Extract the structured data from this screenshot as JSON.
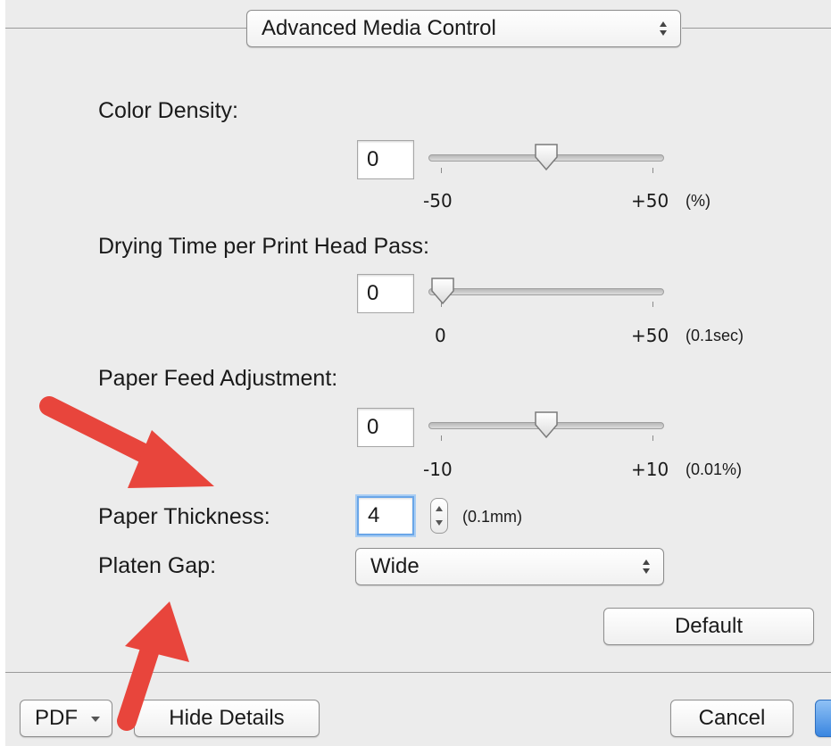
{
  "header": {
    "panel_popup": "Advanced Media Control"
  },
  "sections": {
    "color_density": {
      "label": "Color Density:",
      "value": "0",
      "min_label": "-50",
      "max_label": "+50",
      "unit": "(%)",
      "slider_fraction": 0.5
    },
    "drying_time": {
      "label": "Drying Time per Print Head Pass:",
      "value": "0",
      "min_label": "0",
      "max_label": "+50",
      "unit": "(0.1sec)",
      "slider_fraction": 0.0
    },
    "paper_feed": {
      "label": "Paper Feed Adjustment:",
      "value": "0",
      "min_label": "-10",
      "max_label": "+10",
      "unit": "(0.01%)",
      "slider_fraction": 0.5
    },
    "paper_thickness": {
      "label": "Paper Thickness:",
      "value": "4",
      "unit": "(0.1mm)"
    },
    "platen_gap": {
      "label": "Platen Gap:",
      "selected": "Wide"
    }
  },
  "buttons": {
    "default": "Default",
    "pdf": "PDF",
    "hide_details": "Hide Details",
    "cancel": "Cancel"
  },
  "colors": {
    "annotation_arrow": "#e8453c",
    "focus_ring": "#6aa6e8",
    "panel_bg": "#ececec"
  }
}
